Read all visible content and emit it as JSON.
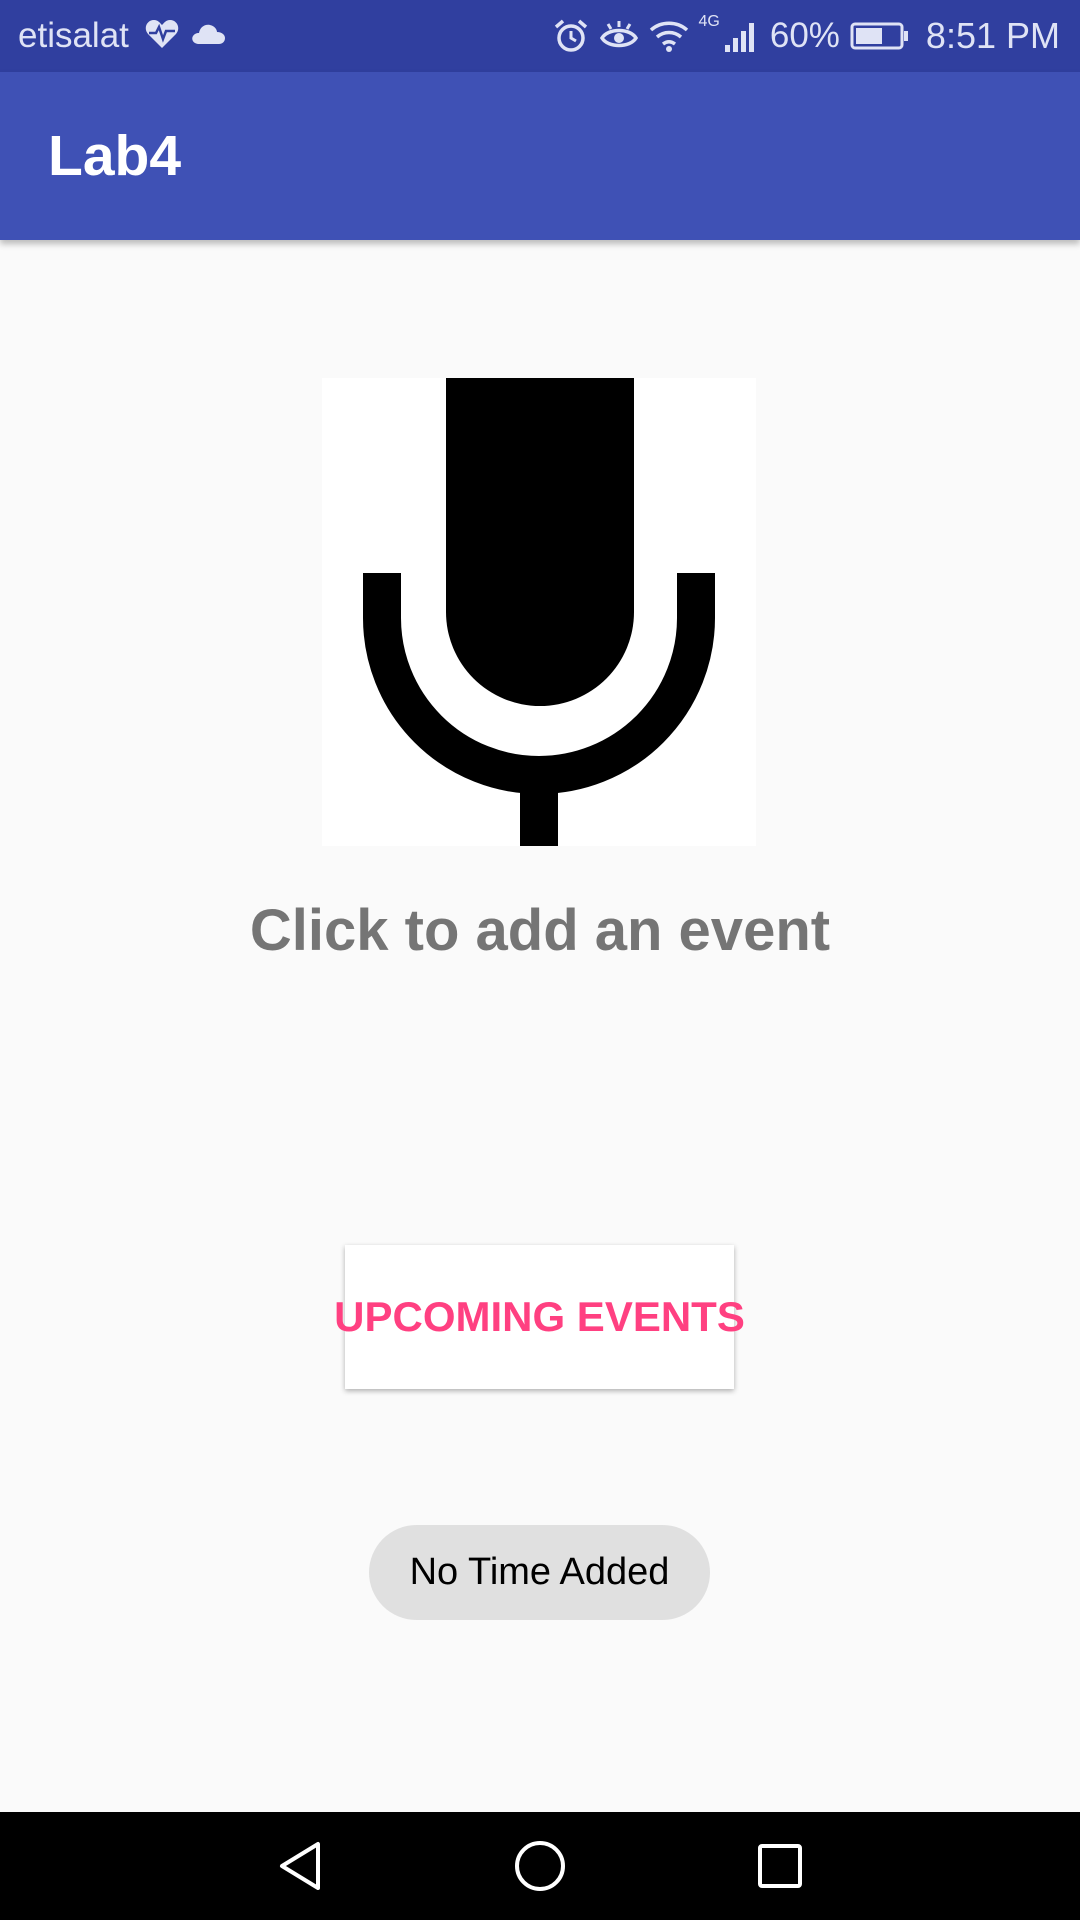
{
  "status_bar": {
    "carrier": "etisalat",
    "network_type": "4G",
    "battery_percent": "60%",
    "time": "8:51 PM",
    "left_icons": [
      "health-icon",
      "cloud-icon"
    ],
    "right_icons": [
      "alarm-icon",
      "eye-comfort-icon",
      "wifi-icon",
      "signal-icon",
      "battery-icon"
    ]
  },
  "app_bar": {
    "title": "Lab4"
  },
  "main": {
    "mic_icon": "microphone-icon",
    "prompt": "Click to add an event",
    "upcoming_button": "UPCOMING EVENTS",
    "time_chip": "No Time Added"
  },
  "nav_bar": {
    "buttons": [
      "back-icon",
      "home-icon",
      "recents-icon"
    ]
  },
  "colors": {
    "status_bar": "#303f9f",
    "primary": "#3f51b5",
    "accent": "#ff4081",
    "prompt_text": "#757575",
    "chip_bg": "#e0e0e0"
  }
}
